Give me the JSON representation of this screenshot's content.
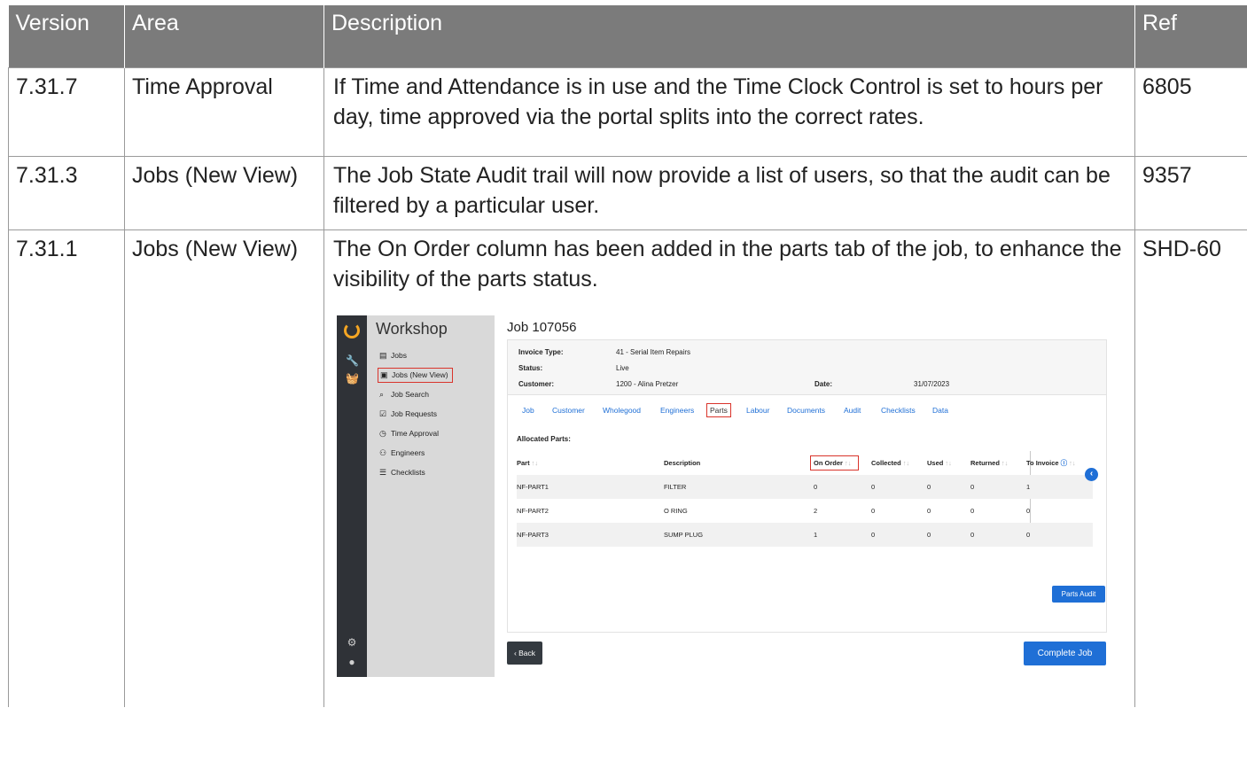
{
  "table": {
    "headers": {
      "version": "Version",
      "area": "Area",
      "description": "Description",
      "ref": "Ref"
    },
    "rows": [
      {
        "version": "7.31.7",
        "area": "Time Approval",
        "description": "If Time and Attendance is in use and the Time Clock Control is set to hours per day, time approved via the portal splits into the correct rates.",
        "ref": "6805"
      },
      {
        "version": "7.31.3",
        "area": "Jobs (New View)",
        "description": "The Job State Audit trail will now provide a list of users, so that the audit can be filtered by a particular user.",
        "ref": "9357"
      },
      {
        "version": "7.31.1",
        "area": "Jobs (New View)",
        "description": "The On Order column has been added in the parts tab of the job, to enhance the visibility of the parts status.",
        "ref": "SHD-60"
      }
    ]
  },
  "screenshot": {
    "app_title": "Workshop",
    "menu": [
      {
        "label": "Jobs",
        "icon": "clipboard-icon"
      },
      {
        "label": "Jobs (New View)",
        "icon": "board-icon",
        "selected": true
      },
      {
        "label": "Job Search",
        "icon": "search-icon"
      },
      {
        "label": "Job Requests",
        "icon": "clipboard-check-icon"
      },
      {
        "label": "Time Approval",
        "icon": "clock-icon"
      },
      {
        "label": "Engineers",
        "icon": "users-icon"
      },
      {
        "label": "Checklists",
        "icon": "checklist-icon"
      }
    ],
    "job_title": "Job 107056",
    "info": {
      "invoice_type_label": "Invoice Type:",
      "invoice_type": "41 - Serial Item Repairs",
      "status_label": "Status:",
      "status": "Live",
      "customer_label": "Customer:",
      "customer": "1200 - Alina Pretzer",
      "date_label": "Date:",
      "date": "31/07/2023"
    },
    "tabs": [
      "Job",
      "Customer",
      "Wholegood",
      "Engineers",
      "Parts",
      "Labour",
      "Documents",
      "Audit",
      "Checklists",
      "Data"
    ],
    "active_tab": "Parts",
    "allocated_label": "Allocated Parts:",
    "columns": [
      "Part",
      "Description",
      "On Order",
      "Collected",
      "Used",
      "Returned",
      "To Invoice"
    ],
    "rows": [
      {
        "part": "NF-PART1",
        "description": "FILTER",
        "on_order": "0",
        "collected": "0",
        "used": "0",
        "returned": "0",
        "to_invoice": "1"
      },
      {
        "part": "NF-PART2",
        "description": "O RING",
        "on_order": "2",
        "collected": "0",
        "used": "0",
        "returned": "0",
        "to_invoice": "0"
      },
      {
        "part": "NF-PART3",
        "description": "SUMP PLUG",
        "on_order": "1",
        "collected": "0",
        "used": "0",
        "returned": "0",
        "to_invoice": "0"
      }
    ],
    "buttons": {
      "parts_audit": "Parts Audit",
      "back": "Back",
      "complete_job": "Complete Job"
    },
    "colors": {
      "rail": "#2f3237",
      "accent": "#f5a623",
      "primary": "#1f6fd6",
      "highlight": "#d9342b",
      "header_grey": "#7b7b7b"
    }
  }
}
